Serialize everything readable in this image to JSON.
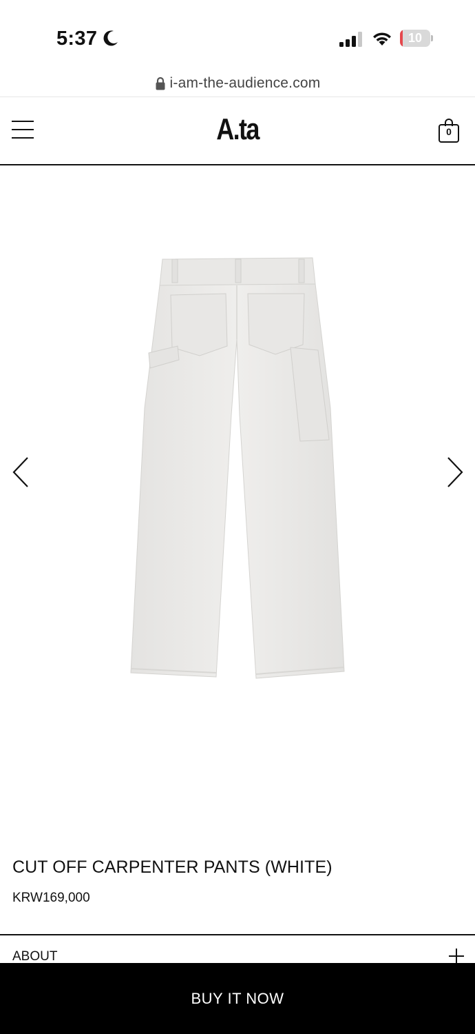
{
  "status_bar": {
    "time": "5:37",
    "battery_level": "10",
    "battery_fraction": 0.1,
    "icons": [
      "moon-icon",
      "signal-icon",
      "wifi-icon",
      "battery-icon"
    ]
  },
  "browser": {
    "url": "i-am-the-audience.com"
  },
  "header": {
    "logo": "A.ta",
    "cart_count": "0",
    "icons": [
      "menu-icon",
      "cart-icon"
    ]
  },
  "gallery": {
    "image_alt": "pants-image",
    "icons": [
      "chevron-left-icon",
      "chevron-right-icon"
    ]
  },
  "product": {
    "title": "CUT OFF CARPENTER PANTS (WHITE)",
    "price": "KRW169,000"
  },
  "accordion": {
    "about_label": "ABOUT"
  },
  "actions": {
    "buy_label": "BUY IT NOW"
  },
  "colors": {
    "background": "#ffffff",
    "text": "#111111",
    "buy_button": "#000000",
    "battery_low": "#e5484d",
    "pants": "#ecebea"
  }
}
